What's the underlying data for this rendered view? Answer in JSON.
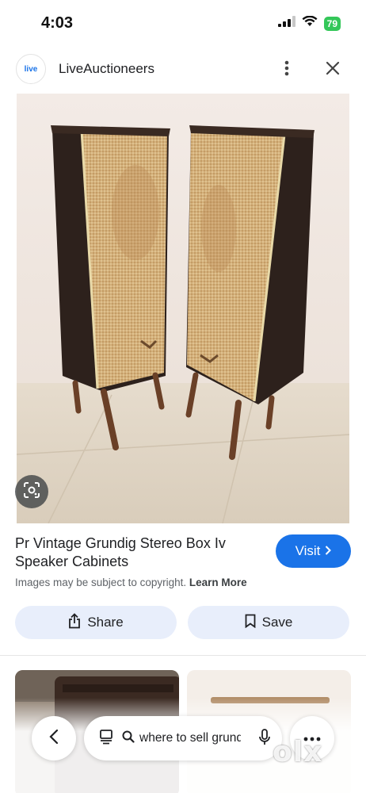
{
  "status": {
    "time": "4:03",
    "battery": "79"
  },
  "header": {
    "site_logo": "live",
    "site_name": "LiveAuctioneers"
  },
  "result": {
    "title": "Pr Vintage Grundig Stereo Box Iv Speaker Cabinets",
    "visit_label": "Visit",
    "copyright_text": "Images may be subject to copyright.",
    "learn_more_label": "Learn More",
    "share_label": "Share",
    "save_label": "Save"
  },
  "search": {
    "query": "where to sell grundig"
  },
  "watermark": "olx",
  "icons": {
    "more": "more-vert-icon",
    "close": "close-icon",
    "lens": "lens-icon",
    "share": "share-icon",
    "save": "bookmark-icon",
    "back": "back-icon",
    "tabs": "tab-switch-icon",
    "search": "search-icon",
    "mic": "mic-icon",
    "menu": "more-horiz-icon"
  },
  "colors": {
    "accent": "#1a73e8",
    "chip_bg": "#e8eefb",
    "battery": "#34c759"
  }
}
